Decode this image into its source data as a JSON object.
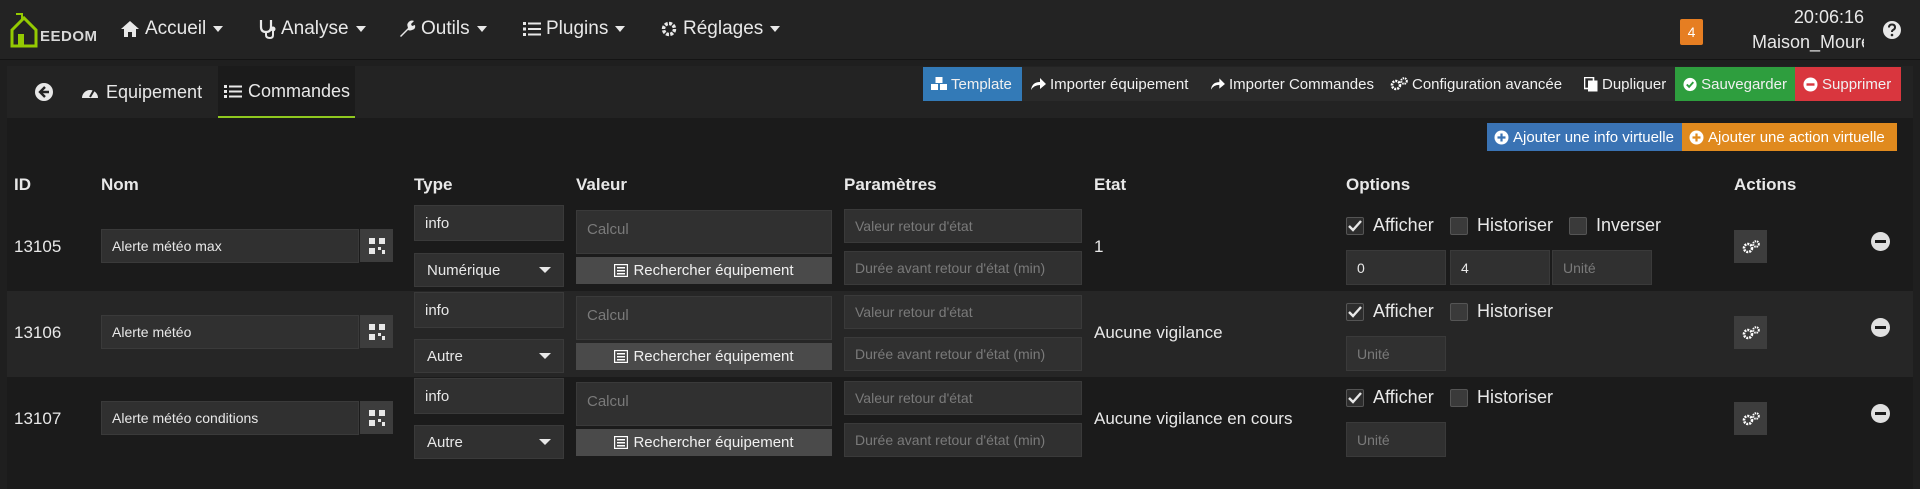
{
  "nav": {
    "logo_text": "EEDOM",
    "menus": [
      {
        "label": "Accueil"
      },
      {
        "label": "Analyse"
      },
      {
        "label": "Outils"
      },
      {
        "label": "Plugins"
      },
      {
        "label": "Réglages"
      }
    ],
    "notification_count": "4",
    "time": "20:06:16",
    "site_name": "Maison_Moure"
  },
  "tabs": [
    {
      "label": "Equipement"
    },
    {
      "label": "Commandes"
    }
  ],
  "toolbar": {
    "template": "Template",
    "import_equipment": "Importer équipement",
    "import_commands": "Importer Commandes",
    "advanced_config": "Configuration avancée",
    "duplicate": "Dupliquer",
    "save": "Sauvegarder",
    "delete": "Supprimer"
  },
  "virtual": {
    "add_info": "Ajouter une info virtuelle",
    "add_action": "Ajouter une action virtuelle"
  },
  "table": {
    "headers": {
      "id": "ID",
      "name": "Nom",
      "type": "Type",
      "value": "Valeur",
      "params": "Paramètres",
      "state": "Etat",
      "options": "Options",
      "actions": "Actions"
    },
    "placeholders": {
      "calc": "Calcul",
      "return_value": "Valeur retour d'état",
      "return_delay": "Durée avant retour d'état (min)",
      "unit": "Unité"
    },
    "search_equipment": "Rechercher équipement",
    "option_labels": {
      "display": "Afficher",
      "historize": "Historiser",
      "invert": "Inverser"
    },
    "rows": [
      {
        "id": "13105",
        "name": "Alerte météo max",
        "type": "info",
        "subtype": "Numérique",
        "state": "1",
        "display": true,
        "historize": false,
        "invert": false,
        "min": "0",
        "max": "4"
      },
      {
        "id": "13106",
        "name": "Alerte météo",
        "type": "info",
        "subtype": "Autre",
        "state": "Aucune vigilance",
        "display": true,
        "historize": false
      },
      {
        "id": "13107",
        "name": "Alerte météo conditions",
        "type": "info",
        "subtype": "Autre",
        "state": "Aucune vigilance en cours",
        "display": true,
        "historize": false
      }
    ]
  },
  "colors": {
    "template_btn": "#337ab7",
    "save_btn": "#2e9e3e",
    "delete_btn": "#d9363e",
    "add_info_btn": "#3a73b4",
    "add_action_btn": "#e08a1e",
    "badge": "#e67e22",
    "active_tab_underline": "#8fc81f"
  }
}
